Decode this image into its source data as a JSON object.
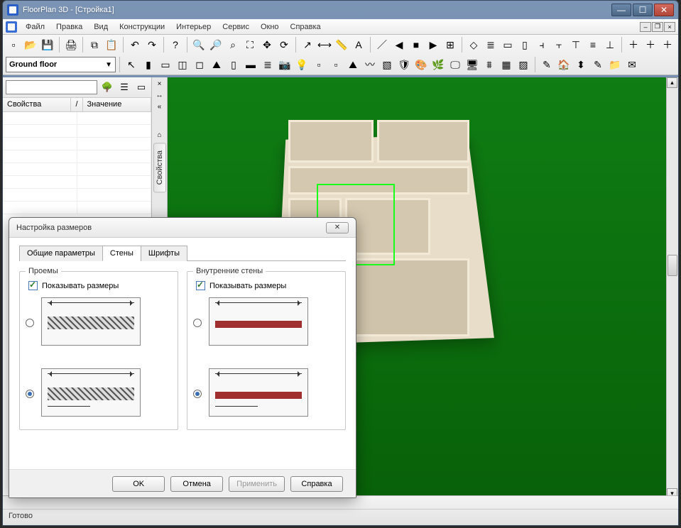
{
  "window": {
    "title": "FloorPlan 3D - [Стройка1]"
  },
  "menu": {
    "items": [
      "Файл",
      "Правка",
      "Вид",
      "Конструкции",
      "Интерьер",
      "Сервис",
      "Окно",
      "Справка"
    ]
  },
  "floor_selector": {
    "value": "Ground floor"
  },
  "toolbar1_icons": [
    "new-file-icon",
    "open-file-icon",
    "save-icon",
    "print-icon",
    "copy-icon",
    "paste-icon",
    "undo-icon",
    "redo-icon",
    "help-icon",
    "zoom-in-icon",
    "zoom-out-icon",
    "zoom-region-icon",
    "zoom-fit-icon",
    "pan-icon",
    "rotate-icon",
    "arrow-icon",
    "dimension-icon",
    "measure-icon",
    "text-icon",
    "line-icon",
    "align-left-icon",
    "align-center-icon",
    "align-right-icon",
    "grid-icon",
    "snap-icon",
    "layer-icon",
    "group-a-icon",
    "group-b-icon",
    "distribute-h-icon",
    "distribute-v-icon",
    "align-top-icon",
    "align-middle-icon",
    "align-bottom-icon",
    "add-icon",
    "add2-icon",
    "add3-icon"
  ],
  "toolbar2_icons": [
    "select-icon",
    "wall-icon",
    "door-icon",
    "window-icon",
    "opening-icon",
    "roof-icon",
    "column-icon",
    "beam-icon",
    "stairs-icon",
    "camera-icon",
    "light-icon",
    "box-icon",
    "box2-icon",
    "terrain-icon",
    "path-icon",
    "area-icon",
    "security-icon",
    "paint-icon",
    "plant-icon",
    "screen-icon",
    "display-icon",
    "fence-icon",
    "hatch-icon",
    "texture-icon",
    "edit-tool-icon",
    "home-icon",
    "level-icon",
    "note-icon",
    "folder-icon",
    "mail-icon"
  ],
  "properties_panel": {
    "mini_icons": [
      "tree-icon",
      "filter-icon",
      "select-all-icon"
    ],
    "columns": {
      "property": "Свойства",
      "separator": "/",
      "value": "Значение"
    },
    "side_tab_label": "Свойства"
  },
  "dialog": {
    "title": "Настройка размеров",
    "tabs": {
      "general": "Общие параметры",
      "walls": "Стены",
      "fonts": "Шрифты",
      "active": "walls"
    },
    "groups": {
      "openings": {
        "legend": "Проемы",
        "checkbox": "Показывать размеры",
        "checked": true,
        "selected_option": 1
      },
      "interior": {
        "legend": "Внутренние стены",
        "checkbox": "Показывать размеры",
        "checked": true,
        "selected_option": 1
      }
    },
    "buttons": {
      "ok": "OK",
      "cancel": "Отмена",
      "apply": "Применить",
      "help": "Справка"
    }
  },
  "status": {
    "text": "Готово"
  }
}
